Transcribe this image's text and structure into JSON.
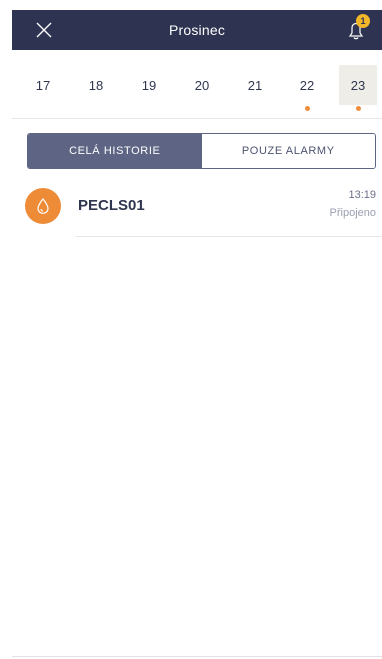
{
  "header": {
    "title": "Prosinec",
    "notification_count": "1"
  },
  "days": [
    {
      "label": "17",
      "has_dot": false,
      "selected": false
    },
    {
      "label": "18",
      "has_dot": false,
      "selected": false
    },
    {
      "label": "19",
      "has_dot": false,
      "selected": false
    },
    {
      "label": "20",
      "has_dot": false,
      "selected": false
    },
    {
      "label": "21",
      "has_dot": false,
      "selected": false
    },
    {
      "label": "22",
      "has_dot": true,
      "selected": false
    },
    {
      "label": "23",
      "has_dot": true,
      "selected": true
    }
  ],
  "filter": {
    "all_label": "CELÁ HISTORIE",
    "alarms_label": "POUZE ALARMY",
    "active": "all"
  },
  "history": [
    {
      "name": "PECLS01",
      "time": "13:19",
      "status": "Připojeno",
      "icon": "drop-icon"
    }
  ],
  "colors": {
    "header_bg": "#2d3350",
    "accent": "#ee8b37",
    "segment_active": "#5e6584",
    "badge": "#f2b728",
    "selected_day_bg": "#efede8"
  }
}
